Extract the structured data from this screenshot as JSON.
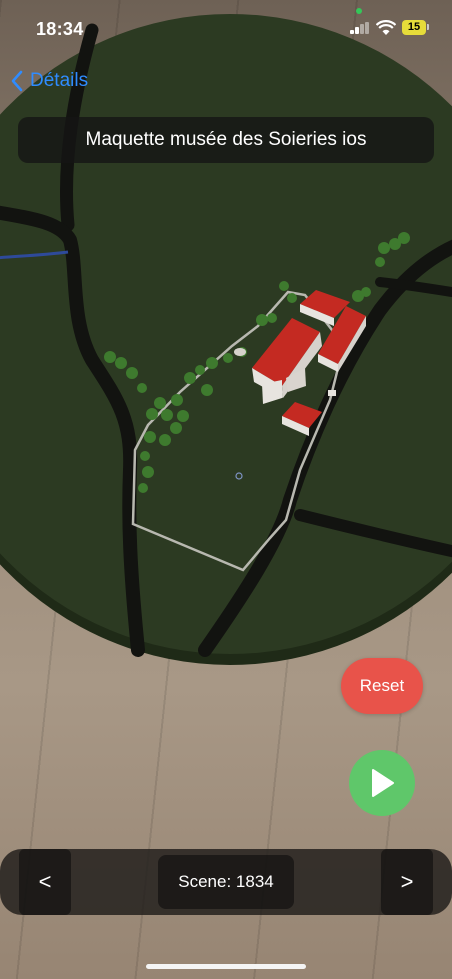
{
  "status_bar": {
    "time": "18:34",
    "battery_level": "15"
  },
  "navigation": {
    "back_label": "Détails"
  },
  "header": {
    "title": "Maquette musée des Soieries ios"
  },
  "controls": {
    "reset_label": "Reset",
    "play_icon": "play-icon"
  },
  "scene_nav": {
    "prev_label": "<",
    "scene_label": "Scene: 1834",
    "next_label": ">"
  },
  "colors": {
    "back_link": "#2f8cff",
    "reset_button": "#e8534a",
    "play_button": "#5fc76a",
    "terrain": "#2c3a22",
    "roofs": "#c42a22"
  }
}
